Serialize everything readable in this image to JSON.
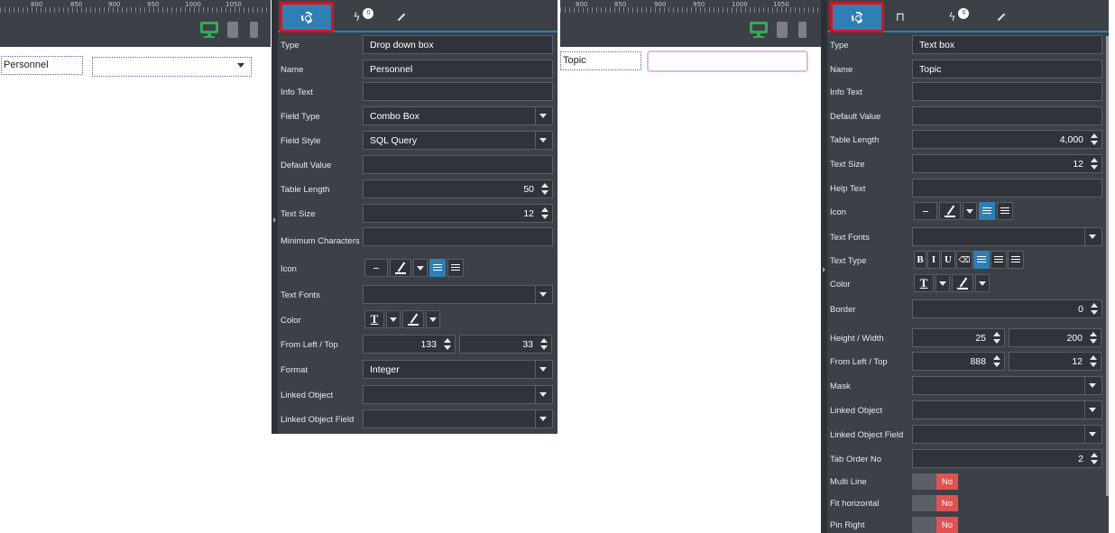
{
  "left": {
    "ruler_labels": [
      "800",
      "850",
      "900",
      "950",
      "1000",
      "1050"
    ],
    "canvas": {
      "label": "Personnel"
    },
    "tabs": {
      "events_count": "0"
    },
    "rows": [
      {
        "label": "Type",
        "value": "Drop down box",
        "kind": "text"
      },
      {
        "label": "Name",
        "value": "Personnel",
        "kind": "text"
      },
      {
        "label": "Info Text",
        "value": "",
        "kind": "text"
      },
      {
        "label": "Field Type",
        "value": "Combo Box",
        "kind": "select"
      },
      {
        "label": "Field Style",
        "value": "SQL Query",
        "kind": "select"
      },
      {
        "label": "Default Value",
        "value": "",
        "kind": "text"
      },
      {
        "label": "Table Length",
        "value": "50",
        "kind": "number"
      },
      {
        "label": "Text Size",
        "value": "12",
        "kind": "number"
      },
      {
        "label": "Minimum Characters",
        "value": "",
        "kind": "text"
      },
      {
        "label": "Icon",
        "value": "",
        "kind": "icon"
      },
      {
        "label": "Text Fonts",
        "value": "",
        "kind": "select"
      },
      {
        "label": "Color",
        "value": "",
        "kind": "color"
      },
      {
        "label": "From Left / Top",
        "value": "133",
        "value2": "33",
        "kind": "pair"
      },
      {
        "label": "Format",
        "value": "Integer",
        "kind": "select"
      },
      {
        "label": "Linked Object",
        "value": "",
        "kind": "select"
      },
      {
        "label": "Linked Object Field",
        "value": "",
        "kind": "select"
      }
    ]
  },
  "right": {
    "ruler_labels": [
      "800",
      "850",
      "900",
      "950",
      "1000",
      "1050"
    ],
    "canvas": {
      "label": "Topic"
    },
    "tabs": {
      "events_count": "0"
    },
    "rows": [
      {
        "label": "Type",
        "value": "Text box",
        "kind": "text"
      },
      {
        "label": "Name",
        "value": "Topic",
        "kind": "text"
      },
      {
        "label": "Info Text",
        "value": "",
        "kind": "text"
      },
      {
        "label": "Default Value",
        "value": "",
        "kind": "text"
      },
      {
        "label": "Table Length",
        "value": "4,000",
        "kind": "number"
      },
      {
        "label": "Text Size",
        "value": "12",
        "kind": "number"
      },
      {
        "label": "Help Text",
        "value": "",
        "kind": "text"
      },
      {
        "label": "Icon",
        "value": "",
        "kind": "icon"
      },
      {
        "label": "Text Fonts",
        "value": "",
        "kind": "select"
      },
      {
        "label": "Text Type",
        "value": "",
        "kind": "texttype"
      },
      {
        "label": "Color",
        "value": "",
        "kind": "color"
      },
      {
        "label": "Border",
        "value": "0",
        "kind": "number"
      },
      {
        "label": "Height / Width",
        "value": "25",
        "value2": "200",
        "kind": "pair"
      },
      {
        "label": "From Left / Top",
        "value": "888",
        "value2": "12",
        "kind": "pair"
      },
      {
        "label": "Mask",
        "value": "",
        "kind": "select"
      },
      {
        "label": "Linked Object",
        "value": "",
        "kind": "select"
      },
      {
        "label": "Linked Object Field",
        "value": "",
        "kind": "select"
      },
      {
        "label": "Tab Order No",
        "value": "2",
        "kind": "number"
      },
      {
        "label": "Multi Line",
        "value": "No",
        "kind": "toggle"
      },
      {
        "label": "Fit horizontal",
        "value": "No",
        "kind": "toggle"
      },
      {
        "label": "Pin Right",
        "value": "No",
        "kind": "toggle"
      }
    ]
  },
  "format_buttons": {
    "bold": "B",
    "italic": "I",
    "underline": "U",
    "text_color": "T"
  },
  "colors": {
    "accent": "#2f7fb5",
    "highlight": "#e0101a",
    "toggle_no": "#e25252",
    "panel": "#3c4148"
  }
}
